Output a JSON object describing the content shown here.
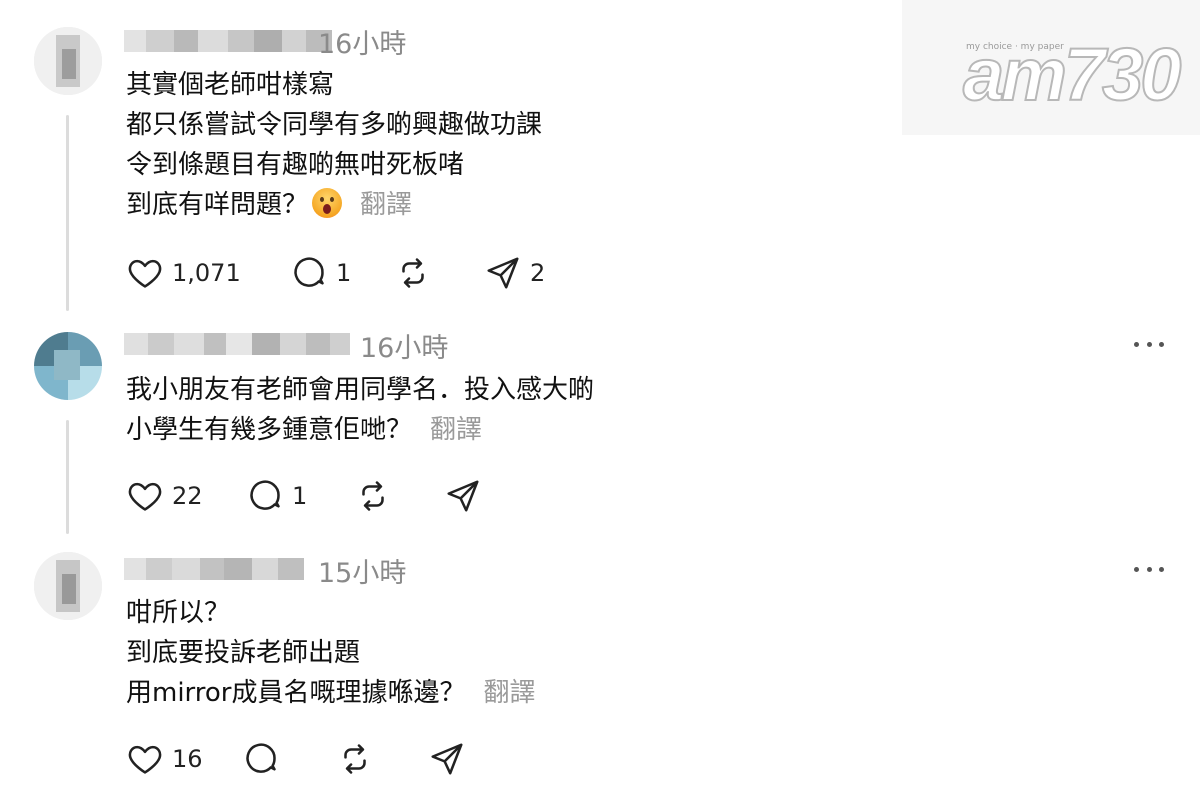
{
  "watermark": {
    "logo": "am730",
    "tagline": "my choice · my paper"
  },
  "comments": [
    {
      "time": "16小時",
      "lines": [
        "其實個老師咁樣寫",
        "都只係嘗試令同學有多啲興趣做功課",
        "令到條題目有趣啲無咁死板啫",
        "到底有咩問題？"
      ],
      "emoji": "astonished-face-emoji",
      "translate": "翻譯",
      "likes": "1,071",
      "replies": "1",
      "reposts": "",
      "shares": "2"
    },
    {
      "time": "16小時",
      "lines": [
        "我小朋友有老師會用同學名．投入感大啲",
        "小學生有幾多鍾意佢哋？"
      ],
      "translate": "翻譯",
      "likes": "22",
      "replies": "1",
      "reposts": "",
      "shares": ""
    },
    {
      "time": "15小時",
      "lines": [
        "咁所以？",
        "到底要投訴老師出題",
        "用mirror成員名嘅理據喺邊？"
      ],
      "translate": "翻譯",
      "likes": "16",
      "replies": "",
      "reposts": "",
      "shares": ""
    }
  ],
  "colors": {
    "text": "#101010",
    "muted": "#8a8a8a",
    "thread_line": "#dcdcdc",
    "icon": "#222222"
  },
  "icons": [
    "heart-icon",
    "comment-icon",
    "repost-icon",
    "share-icon",
    "more-icon"
  ]
}
